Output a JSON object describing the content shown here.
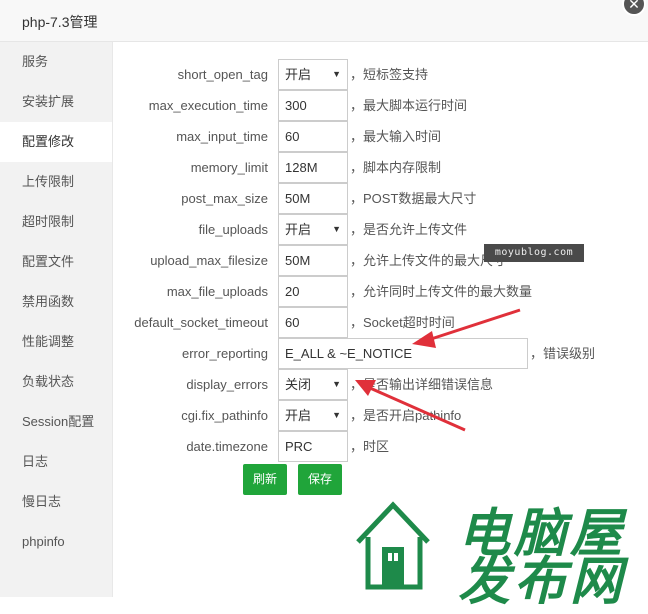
{
  "window": {
    "title": "php-7.3管理"
  },
  "sidebar": {
    "items": [
      {
        "label": "服务"
      },
      {
        "label": "安装扩展"
      },
      {
        "label": "配置修改",
        "active": true
      },
      {
        "label": "上传限制"
      },
      {
        "label": "超时限制"
      },
      {
        "label": "配置文件"
      },
      {
        "label": "禁用函数"
      },
      {
        "label": "性能调整"
      },
      {
        "label": "负载状态"
      },
      {
        "label": "Session配置"
      },
      {
        "label": "日志"
      },
      {
        "label": "慢日志"
      },
      {
        "label": "phpinfo"
      }
    ]
  },
  "settings": [
    {
      "key": "short_open_tag",
      "type": "select",
      "value": "开启",
      "desc": "，短标签支持"
    },
    {
      "key": "max_execution_time",
      "type": "input",
      "value": "300",
      "desc": "，最大脚本运行时间"
    },
    {
      "key": "max_input_time",
      "type": "input",
      "value": "60",
      "desc": "，最大输入时间"
    },
    {
      "key": "memory_limit",
      "type": "input",
      "value": "128M",
      "desc": "，脚本内存限制"
    },
    {
      "key": "post_max_size",
      "type": "input",
      "value": "50M",
      "desc": "，POST数据最大尺寸"
    },
    {
      "key": "file_uploads",
      "type": "select",
      "value": "开启",
      "desc": "，是否允许上传文件"
    },
    {
      "key": "upload_max_filesize",
      "type": "input",
      "value": "50M",
      "desc": "，允许上传文件的最大尺寸"
    },
    {
      "key": "max_file_uploads",
      "type": "input",
      "value": "20",
      "desc": "，允许同时上传文件的最大数量"
    },
    {
      "key": "default_socket_timeout",
      "type": "input",
      "value": "60",
      "desc": "，Socket超时时间"
    },
    {
      "key": "error_reporting",
      "type": "input-wide",
      "value": "E_ALL & ~E_NOTICE",
      "desc": "，错误级别"
    },
    {
      "key": "display_errors",
      "type": "select",
      "value": "关闭",
      "desc": "，是否输出详细错误信息"
    },
    {
      "key": "cgi.fix_pathinfo",
      "type": "select",
      "value": "开启",
      "desc": "，是否开启pathinfo"
    },
    {
      "key": "date.timezone",
      "type": "input",
      "value": "PRC",
      "desc": "，时区"
    }
  ],
  "buttons": {
    "refresh": "刷新",
    "save": "保存"
  },
  "watermark": {
    "url": "moyublog.com",
    "logo_line1": "电脑屋",
    "logo_line2": "发布网"
  },
  "colors": {
    "accent": "#20a53a",
    "annotation_arrow": "#e0303a",
    "logo": "#1e8a4a"
  }
}
